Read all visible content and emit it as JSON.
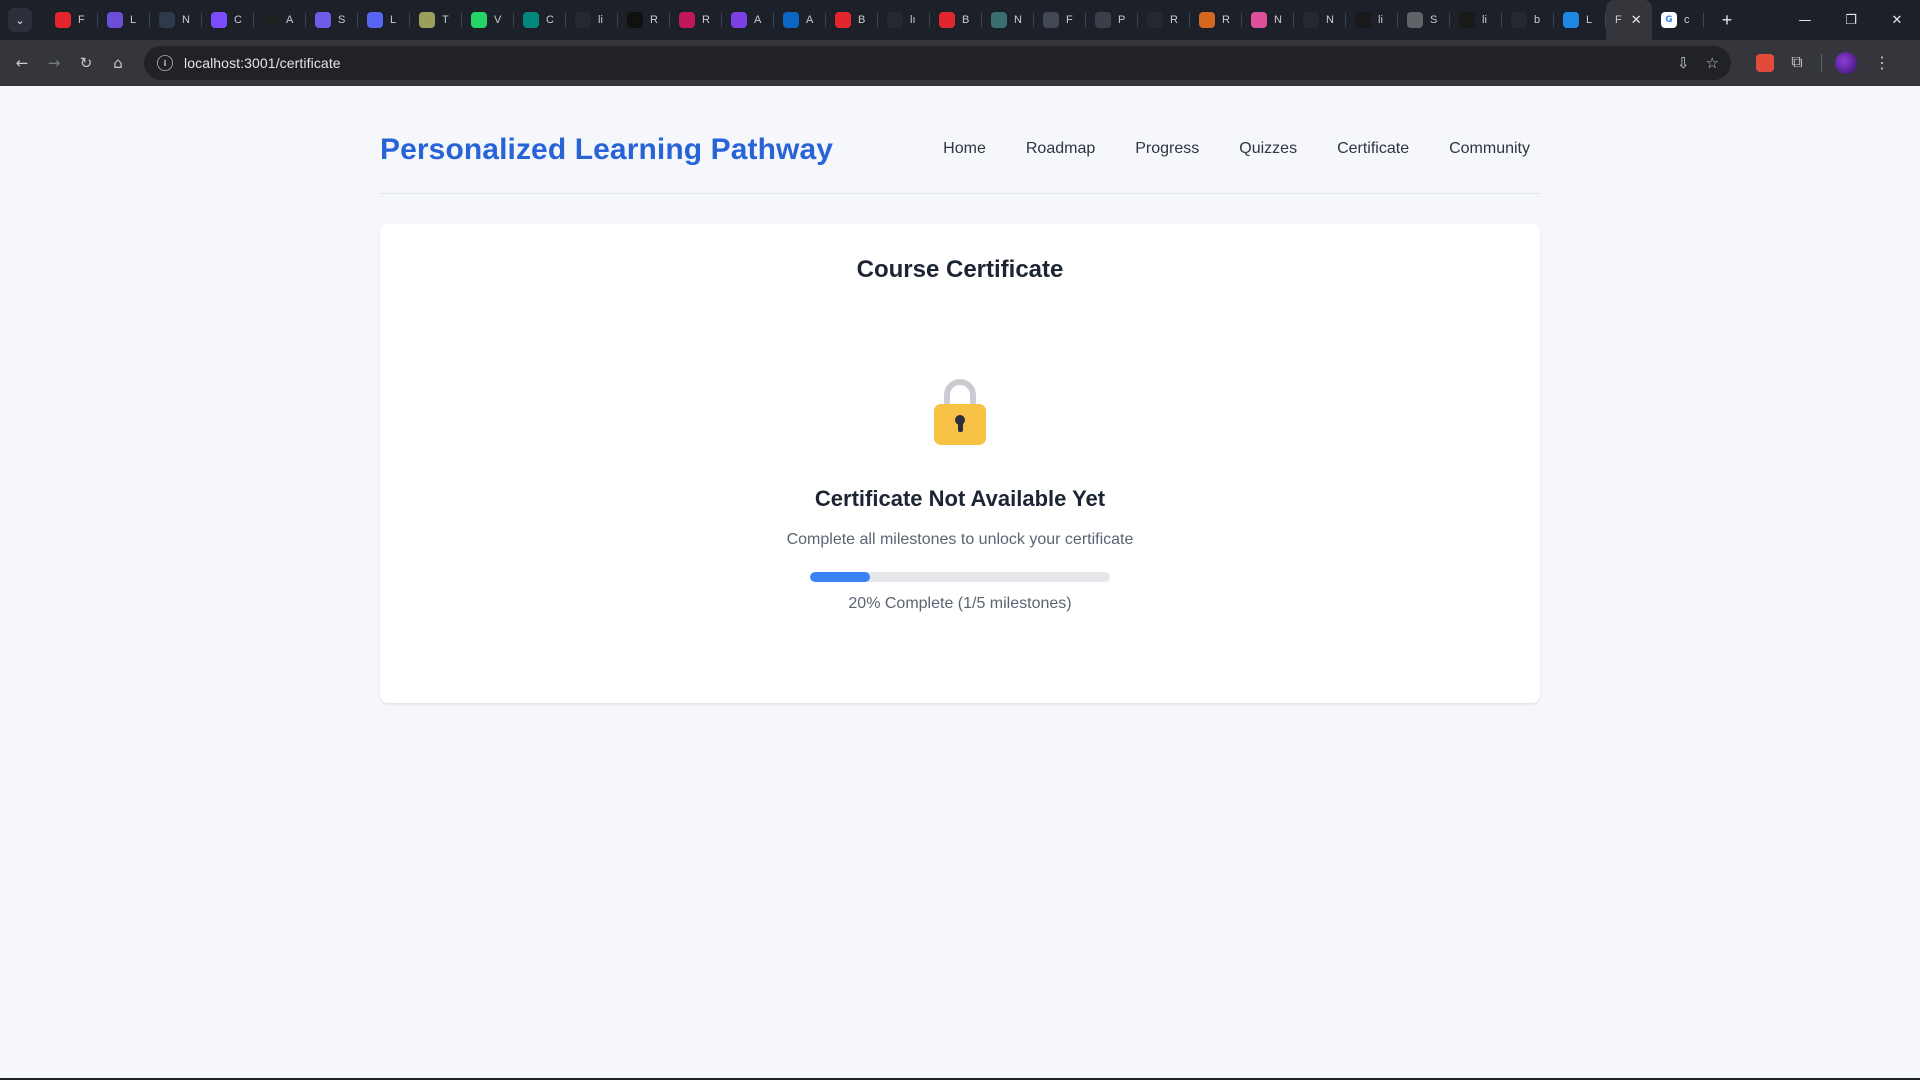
{
  "browser": {
    "tabs": [
      {
        "letter": "F",
        "icon": "youtube-icon",
        "color": "#e3262d"
      },
      {
        "letter": "L",
        "icon": "chart-icon",
        "color": "#6b4fd8"
      },
      {
        "letter": "N",
        "icon": "dark-circle-icon",
        "color": "#2f3a4d"
      },
      {
        "letter": "C",
        "icon": "w-logo-icon",
        "color": "#7c4dff"
      },
      {
        "letter": "A",
        "icon": "openai-icon",
        "color": "#202123"
      },
      {
        "letter": "S",
        "icon": "s-logo-icon",
        "color": "#6c5ce7"
      },
      {
        "letter": "L",
        "icon": "globe-icon",
        "color": "#5865f2"
      },
      {
        "letter": "T",
        "icon": "badge-icon",
        "color": "#9aa05a"
      },
      {
        "letter": "V",
        "icon": "whatsapp-icon",
        "color": "#25d366"
      },
      {
        "letter": "C",
        "icon": "meet-icon",
        "color": "#00897b"
      },
      {
        "letter": "li",
        "icon": "github-icon",
        "color": "#24292f"
      },
      {
        "letter": "R",
        "icon": "n-logo-icon",
        "color": "#111111"
      },
      {
        "letter": "R",
        "icon": "react-icon",
        "color": "#c2185b"
      },
      {
        "letter": "A",
        "icon": "shield-icon",
        "color": "#7b3fe4"
      },
      {
        "letter": "A",
        "icon": "linkedin-icon",
        "color": "#0a66c2"
      },
      {
        "letter": "B",
        "icon": "youtube-icon",
        "color": "#e3262d"
      },
      {
        "letter": "lı",
        "icon": "github-icon",
        "color": "#24292f"
      },
      {
        "letter": "B",
        "icon": "youtube-icon",
        "color": "#e3262d"
      },
      {
        "letter": "N",
        "icon": "image-icon",
        "color": "#3c6e71"
      },
      {
        "letter": "F",
        "icon": "pen-icon",
        "color": "#444a55"
      },
      {
        "letter": "P",
        "icon": "target-icon",
        "color": "#3a3f4a"
      },
      {
        "letter": "R",
        "icon": "github-icon",
        "color": "#24292f"
      },
      {
        "letter": "R",
        "icon": "asterisk-icon",
        "color": "#d2691e"
      },
      {
        "letter": "N",
        "icon": "cube-icon",
        "color": "#e04e9a"
      },
      {
        "letter": "N",
        "icon": "github-icon",
        "color": "#24292f"
      },
      {
        "letter": "li",
        "icon": "triangle-icon",
        "color": "#1a1a1a"
      },
      {
        "letter": "S",
        "icon": "globe-icon",
        "color": "#5f6368"
      },
      {
        "letter": "li",
        "icon": "triangle-icon",
        "color": "#1a1a1a"
      },
      {
        "letter": "b",
        "icon": "github-icon",
        "color": "#24292f"
      },
      {
        "letter": "L",
        "icon": "linkedin-icon",
        "color": "#1e88e5"
      }
    ],
    "active_tab_letter": "F",
    "last_tab_letter": "c",
    "address": "localhost:3001/certificate"
  },
  "site": {
    "brand": "Personalized Learning Pathway",
    "nav": [
      "Home",
      "Roadmap",
      "Progress",
      "Quizzes",
      "Certificate",
      "Community"
    ],
    "brand_color": "#2864d8"
  },
  "certificate": {
    "title": "Course Certificate",
    "status_title": "Certificate Not Available Yet",
    "status_subtitle": "Complete all milestones to unlock your certificate",
    "progress_percent": 20,
    "progress_label": "20% Complete (1/5 milestones)",
    "accent_color": "#3b82f6",
    "lock_color": "#f6c144"
  }
}
